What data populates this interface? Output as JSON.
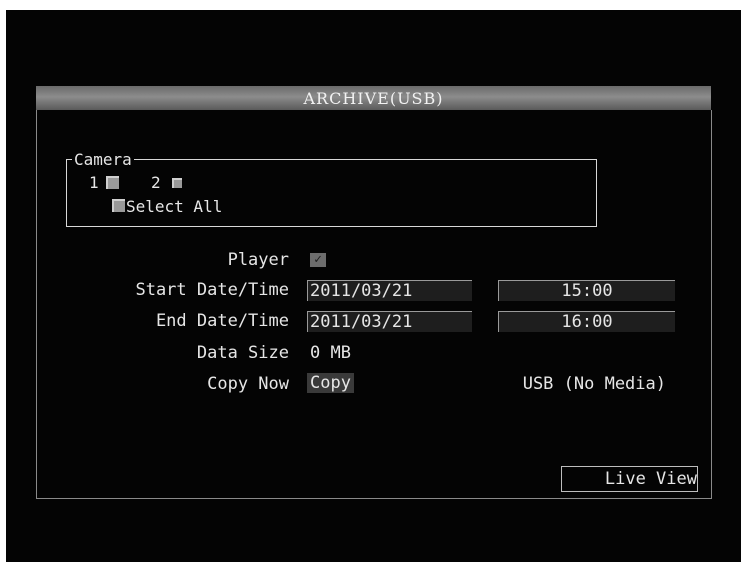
{
  "window": {
    "title": "ARCHIVE(USB)"
  },
  "camera": {
    "legend": "Camera",
    "cam1": "1",
    "cam2": "2",
    "select_all": "Select All"
  },
  "player": {
    "label": "Player",
    "checked": true,
    "check_glyph": "✓"
  },
  "start": {
    "label": "Start Date/Time",
    "date": "2011/03/21",
    "time": "15:00"
  },
  "end": {
    "label": "End Date/Time",
    "date": "2011/03/21",
    "time": "16:00"
  },
  "data_size": {
    "label": "Data Size",
    "value": "0 MB"
  },
  "copy": {
    "label": "Copy Now",
    "button": "Copy",
    "status": "USB (No Media)"
  },
  "live_view": "Live View",
  "icons": {
    "checkbox": "checkbox-icon",
    "check": "check-icon"
  }
}
